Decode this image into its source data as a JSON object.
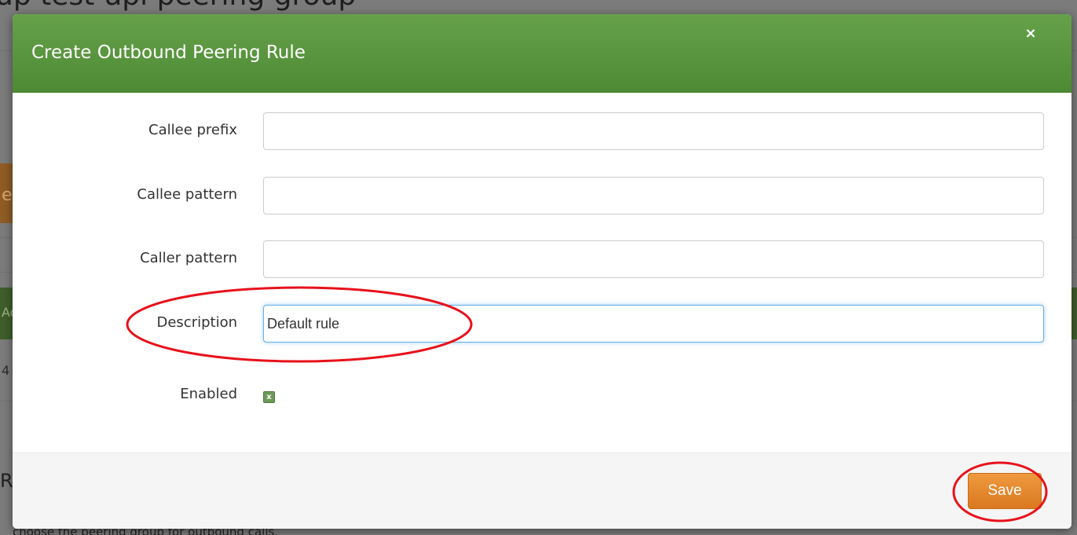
{
  "background": {
    "title_fragment": "up test-api peering group",
    "orange_fragment": "e",
    "green_fragment": "Ac",
    "number_fragment": "4",
    "heading_fragment": "R",
    "footer_text": "choose the peering group for outbound calls."
  },
  "modal": {
    "title": "Create Outbound Peering Rule",
    "close_glyph": "×",
    "fields": {
      "callee_prefix": {
        "label": "Callee prefix",
        "value": ""
      },
      "callee_pattern": {
        "label": "Callee pattern",
        "value": ""
      },
      "caller_pattern": {
        "label": "Caller pattern",
        "value": ""
      },
      "description": {
        "label": "Description",
        "value": "Default rule"
      },
      "enabled": {
        "label": "Enabled",
        "checked": true,
        "glyph": "x"
      }
    },
    "save_label": "Save"
  },
  "colors": {
    "header_green": "#5a9640",
    "save_orange": "#e38a2e",
    "annotation_red": "#e8111b"
  }
}
